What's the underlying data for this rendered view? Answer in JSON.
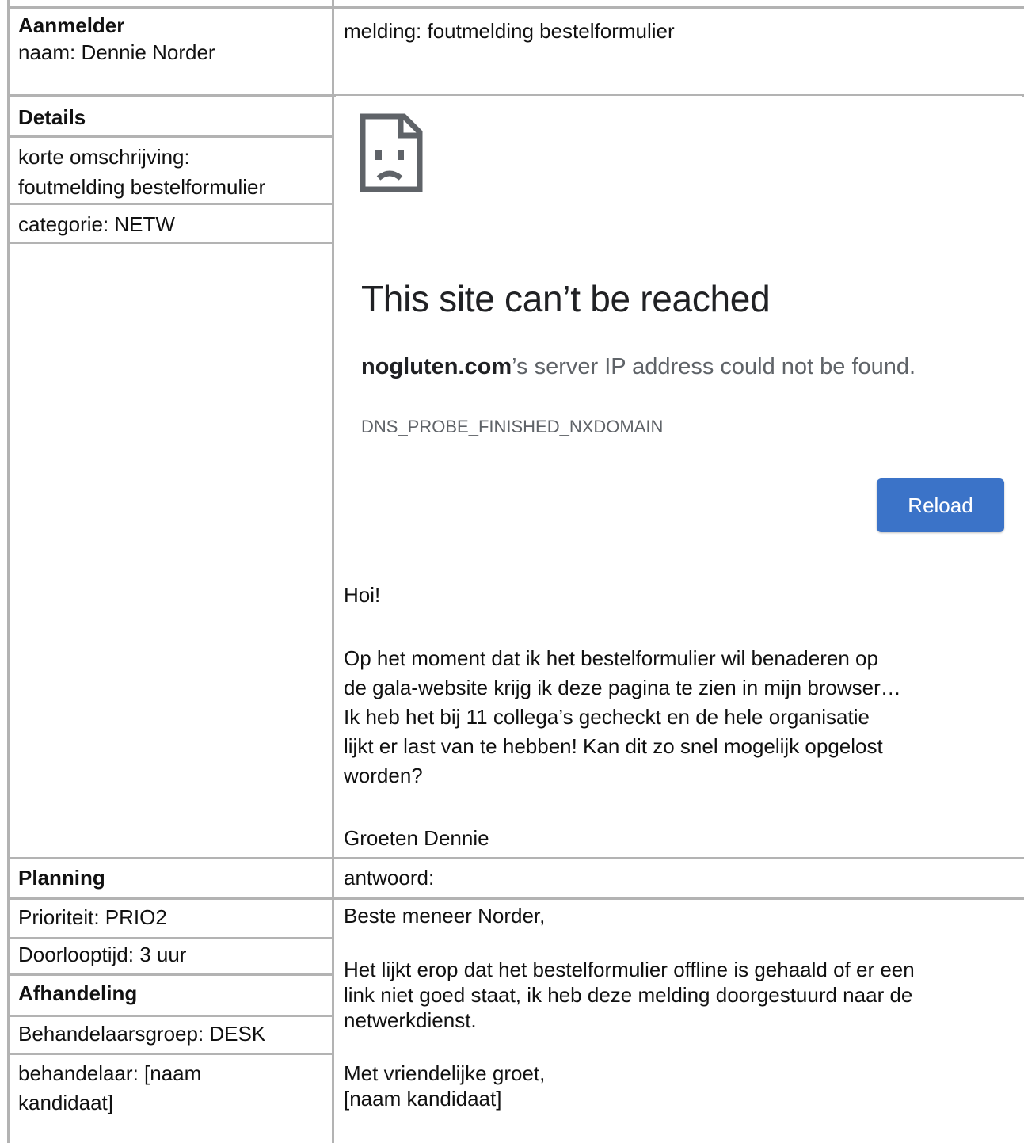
{
  "aanmelder": {
    "heading": "Aanmelder",
    "naam": "naam: Dennie Norder"
  },
  "melding": "melding: foutmelding bestelformulier",
  "details": {
    "heading": "Details",
    "korte_omschrijving_label": "korte omschrijving:",
    "korte_omschrijving_value": "foutmelding bestelformulier",
    "categorie": "categorie: NETW"
  },
  "browser_error": {
    "icon": "sad-page-icon",
    "title": "This site can’t be reached",
    "host": "nogluten.com",
    "detail_rest": "’s server IP address could not be found.",
    "error_code": "DNS_PROBE_FINISHED_NXDOMAIN",
    "reload_label": "Reload",
    "reload_color": "#3b73c8"
  },
  "message": {
    "greeting": "Hoi!",
    "lines": [
      "Op het moment dat ik het bestelformulier wil benaderen op",
      "de gala-website krijg ik deze pagina te zien in mijn browser…",
      "Ik heb het bij 11 collega’s gecheckt en de hele organisatie",
      "lijkt er last van te hebben! Kan dit zo snel mogelijk opgelost",
      "worden?"
    ],
    "closing": "Groeten Dennie"
  },
  "planning": {
    "heading": "Planning",
    "prioriteit": "Prioriteit: PRIO2",
    "doorlooptijd": "Doorlooptijd: 3 uur"
  },
  "afhandeling": {
    "heading": "Afhandeling",
    "behandelaarsgroep": "Behandelaarsgroep: DESK",
    "behandelaar_line1": "behandelaar: [naam",
    "behandelaar_line2": "kandidaat]"
  },
  "antwoord": {
    "label": "antwoord:",
    "salutation": "Beste meneer Norder,",
    "body_lines": [
      "Het lijkt erop dat het bestelformulier offline is gehaald of er een",
      "link niet goed staat, ik heb deze melding doorgestuurd naar de",
      "netwerkdienst."
    ],
    "closing": "Met vriendelijke groet,",
    "signature": "[naam kandidaat]"
  }
}
